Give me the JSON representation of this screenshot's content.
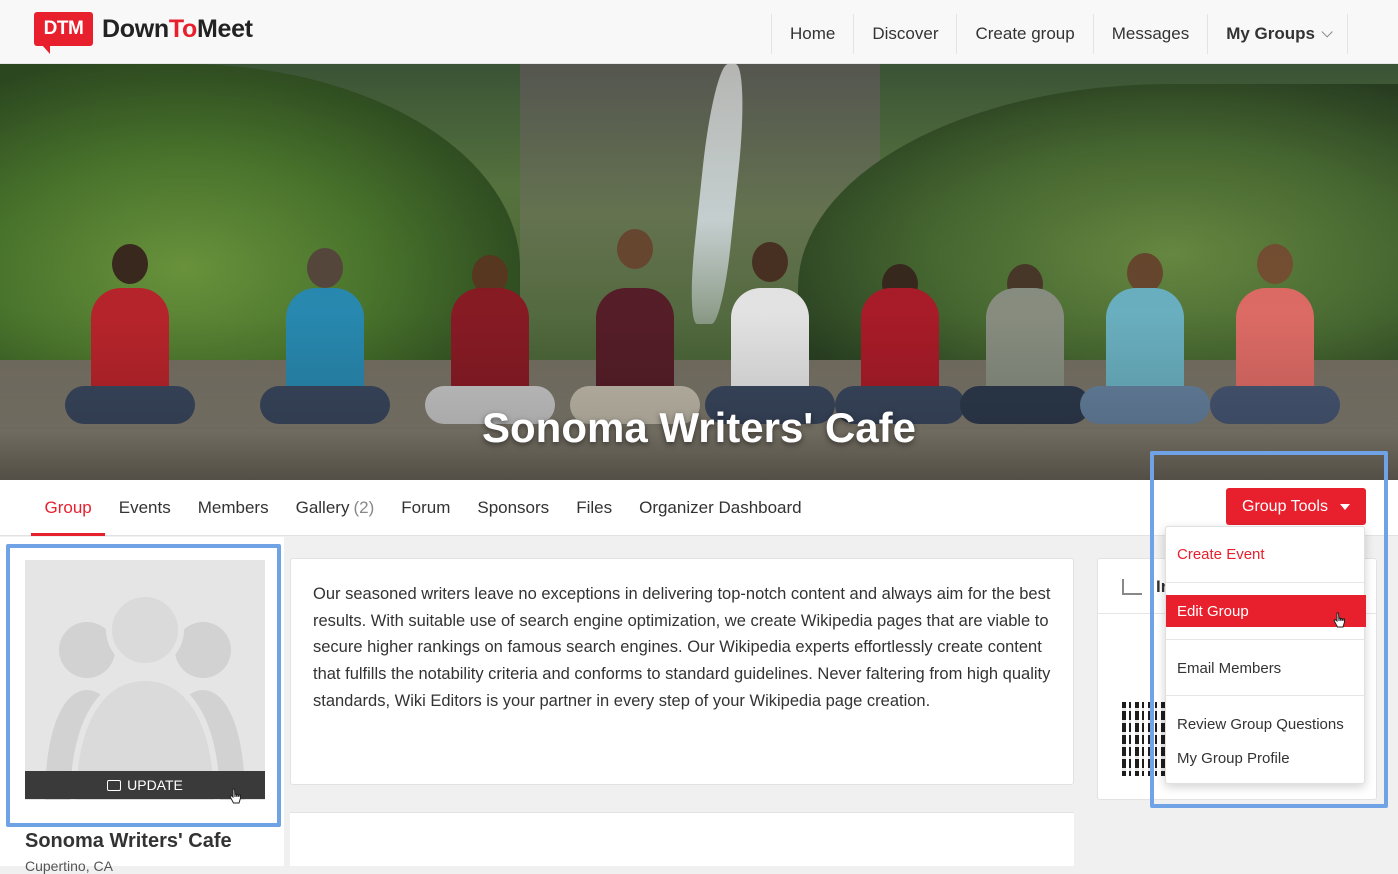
{
  "brand": {
    "badge": "DTM",
    "name_down": "Down",
    "name_to": "To",
    "name_meet": "Meet",
    "color": "#e8202e"
  },
  "topnav": {
    "items": [
      "Home",
      "Discover",
      "Create group",
      "Messages"
    ],
    "my_groups": "My Groups"
  },
  "hero": {
    "title": "Sonoma Writers' Cafe"
  },
  "tabs": {
    "items": [
      {
        "label": "Group",
        "active": true
      },
      {
        "label": "Events"
      },
      {
        "label": "Members"
      },
      {
        "label": "Gallery",
        "count": "(2)"
      },
      {
        "label": "Forum"
      },
      {
        "label": "Sponsors"
      },
      {
        "label": "Files"
      },
      {
        "label": "Organizer Dashboard"
      }
    ]
  },
  "group_tools": {
    "label": "Group Tools",
    "menu": [
      "Create Event",
      "Edit Group",
      "Email Members",
      "Review Group Questions",
      "My Group Profile"
    ],
    "highlighted": "Edit Group"
  },
  "profile": {
    "update_label": "UPDATE",
    "name": "Sonoma Writers' Cafe",
    "location": "Cupertino, CA"
  },
  "description": "Our seasoned writers leave no exceptions in delivering top-notch content and always aim for the best results. With suitable use of search engine optimization, we create Wikipedia pages that are viable to secure higher rankings on famous search engines. Our Wikipedia experts effortlessly create content that fulfills the notability criteria and conforms to standard guidelines. Never faltering from high quality standards, Wiki Editors is your partner in every step of your Wikipedia page creation.",
  "share": {
    "label": "In"
  }
}
